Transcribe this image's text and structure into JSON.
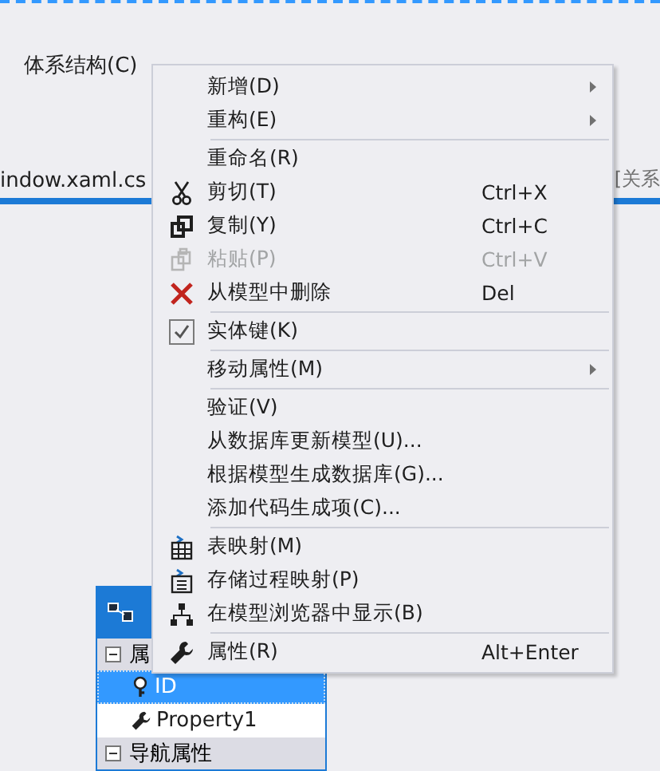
{
  "menu_bar": [
    {
      "label": "体系结构(C)"
    }
  ],
  "document_tab": {
    "label": "indow.xaml.cs"
  },
  "side_label": "[关系",
  "entity": {
    "rows": [
      {
        "kind": "section",
        "label": "属"
      },
      {
        "kind": "property",
        "label": "ID",
        "key": true,
        "selected": true
      },
      {
        "kind": "property",
        "label": "Property1",
        "key": false,
        "selected": false
      },
      {
        "kind": "section",
        "label": "导航属性"
      }
    ]
  },
  "context_menu": {
    "items": [
      {
        "kind": "plain",
        "label": "新增(D)",
        "submenu": true
      },
      {
        "kind": "plain",
        "label": "重构(E)",
        "submenu": true
      },
      {
        "kind": "separator"
      },
      {
        "kind": "plain",
        "label": "重命名(R)",
        "submenu": false
      },
      {
        "kind": "cut",
        "label": "剪切(T)",
        "shortcut": "Ctrl+X"
      },
      {
        "kind": "copy",
        "label": "复制(Y)",
        "shortcut": "Ctrl+C"
      },
      {
        "kind": "paste",
        "label": "粘贴(P)",
        "shortcut": "Ctrl+V",
        "disabled": true
      },
      {
        "kind": "delete",
        "label": "从模型中删除",
        "shortcut": "Del"
      },
      {
        "kind": "separator"
      },
      {
        "kind": "check",
        "label": "实体键(K)",
        "checked": true
      },
      {
        "kind": "separator"
      },
      {
        "kind": "plain",
        "label": "移动属性(M)",
        "submenu": true
      },
      {
        "kind": "separator"
      },
      {
        "kind": "plain",
        "label": "验证(V)"
      },
      {
        "kind": "plain",
        "label": "从数据库更新模型(U)..."
      },
      {
        "kind": "plain",
        "label": "根据模型生成数据库(G)..."
      },
      {
        "kind": "plain",
        "label": "添加代码生成项(C)..."
      },
      {
        "kind": "separator"
      },
      {
        "kind": "table",
        "label": "表映射(M)"
      },
      {
        "kind": "procedure",
        "label": "存储过程映射(P)"
      },
      {
        "kind": "hierarchy",
        "label": "在模型浏览器中显示(B)"
      },
      {
        "kind": "separator"
      },
      {
        "kind": "wrench",
        "label": "属性(R)",
        "shortcut": "Alt+Enter"
      }
    ]
  }
}
